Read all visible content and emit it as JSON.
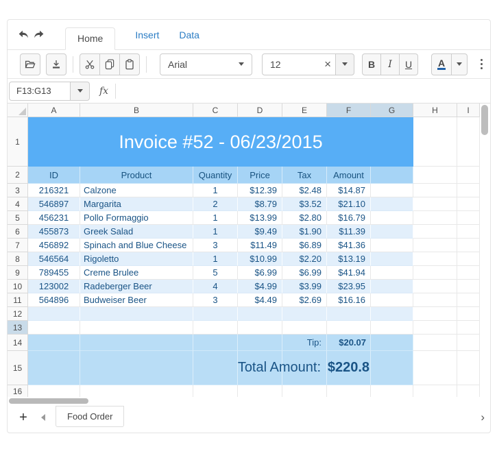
{
  "app": {
    "tabs": [
      {
        "label": "Home",
        "active": true
      },
      {
        "label": "Insert",
        "active": false
      },
      {
        "label": "Data",
        "active": false
      }
    ],
    "toolbar": {
      "font_family_value": "Arial",
      "font_size_value": "12",
      "clear_label": "×",
      "bold_label": "B",
      "italic_label": "I",
      "underline_label": "U",
      "text_color_label": "A",
      "icons": [
        "undo-icon",
        "redo-icon",
        "open-icon",
        "export-icon",
        "cut-icon",
        "copy-icon",
        "paste-icon",
        "dropdown-caret-icon",
        "text-color-icon",
        "overflow-menu-icon"
      ]
    },
    "formula_bar": {
      "name_box_value": "F13:G13",
      "fx_label": "fx",
      "formula_value": ""
    }
  },
  "spreadsheet": {
    "selection": "F13:G13",
    "column_headers": [
      "A",
      "B",
      "C",
      "D",
      "E",
      "F",
      "G",
      "H",
      "I"
    ],
    "selected_columns": [
      "F",
      "G"
    ],
    "selected_row": 13,
    "visible_rows": 16,
    "title_row": {
      "row": 1,
      "text": "Invoice #52 - 06/23/2015"
    },
    "header_row": {
      "row": 2,
      "labels": [
        "ID",
        "Product",
        "Quantity",
        "Price",
        "Tax",
        "Amount"
      ]
    },
    "data_rows": [
      {
        "row": 3,
        "cells": [
          "216321",
          "Calzone",
          "1",
          "$12.39",
          "$2.48",
          "$14.87"
        ]
      },
      {
        "row": 4,
        "cells": [
          "546897",
          "Margarita",
          "2",
          "$8.79",
          "$3.52",
          "$21.10"
        ]
      },
      {
        "row": 5,
        "cells": [
          "456231",
          "Pollo Formaggio",
          "1",
          "$13.99",
          "$2.80",
          "$16.79"
        ]
      },
      {
        "row": 6,
        "cells": [
          "455873",
          "Greek Salad",
          "1",
          "$9.49",
          "$1.90",
          "$11.39"
        ]
      },
      {
        "row": 7,
        "cells": [
          "456892",
          "Spinach and Blue Cheese",
          "3",
          "$11.49",
          "$6.89",
          "$41.36"
        ]
      },
      {
        "row": 8,
        "cells": [
          "546564",
          "Rigoletto",
          "1",
          "$10.99",
          "$2.20",
          "$13.19"
        ]
      },
      {
        "row": 9,
        "cells": [
          "789455",
          "Creme Brulee",
          "5",
          "$6.99",
          "$6.99",
          "$41.94"
        ]
      },
      {
        "row": 10,
        "cells": [
          "123002",
          "Radeberger Beer",
          "4",
          "$4.99",
          "$3.99",
          "$23.95"
        ]
      },
      {
        "row": 11,
        "cells": [
          "564896",
          "Budweiser Beer",
          "3",
          "$4.49",
          "$2.69",
          "$16.16"
        ]
      }
    ],
    "tip_row": {
      "row": 14,
      "label": "Tip:",
      "value": "$20.07"
    },
    "total_row": {
      "row": 15,
      "label": "Total Amount:",
      "value": "$220.8"
    }
  },
  "sheet_bar": {
    "add_label": "+",
    "sheet_name": "Food Order"
  },
  "colors": {
    "invoice_title_bg": "#57aef6",
    "table_header_bg": "#a6d4f6",
    "alt_row_bg": "#e2effb",
    "summary_row_bg": "#b9ddf6",
    "selected_header_bg": "#c9dbe9",
    "cell_text": "#1a5486",
    "tab_link": "#2a7cc4",
    "font_color_underline": "#2162a8"
  }
}
